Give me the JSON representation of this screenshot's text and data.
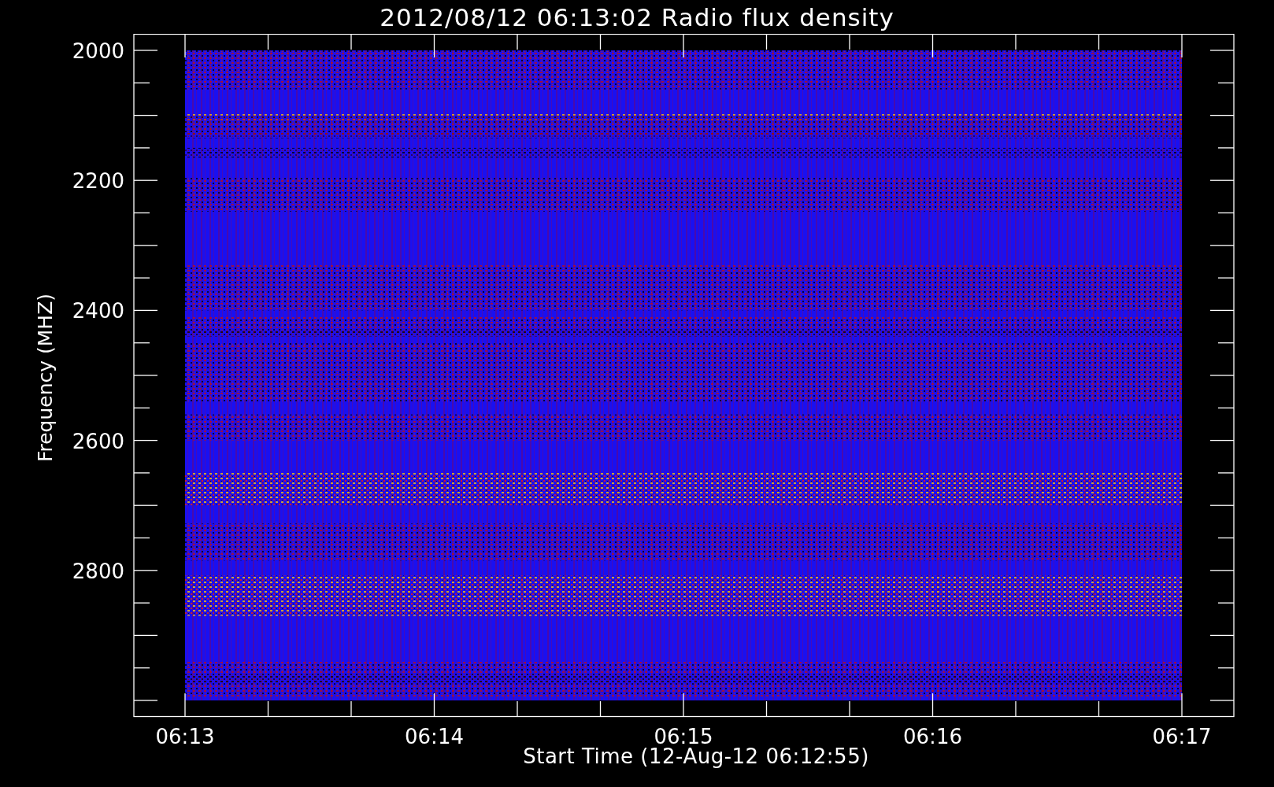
{
  "title": "2012/08/12 06:13:02 Radio flux density",
  "y_axis": {
    "label": "Frequency (MHZ)",
    "ticks": [
      "2000",
      "2200",
      "2400",
      "2600",
      "2800"
    ]
  },
  "x_axis": {
    "label": "Start Time (12-Aug-12 06:12:55)",
    "ticks": [
      "06:13",
      "06:14",
      "06:15",
      "06:16",
      "06:17"
    ]
  }
}
